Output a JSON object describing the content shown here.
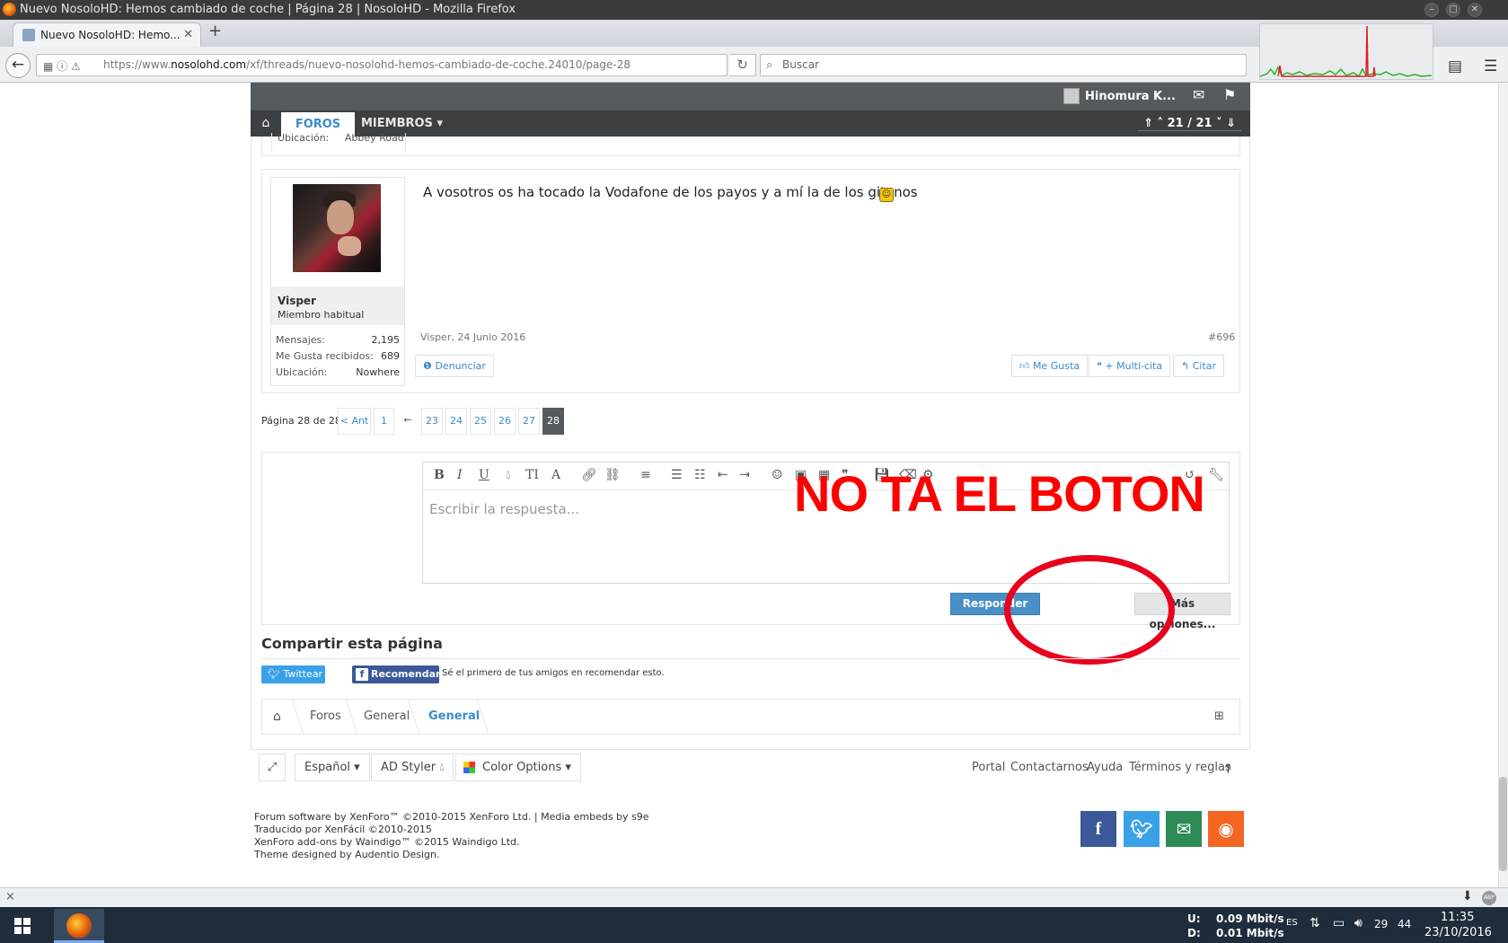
{
  "window": {
    "title": "Nuevo NosoloHD: Hemos cambiado de coche | Página 28 | NosoloHD - Mozilla Firefox"
  },
  "browser": {
    "tab_label": "Nuevo NosoloHD: Hemo...",
    "url_prefix": "https://www.",
    "url_domain": "nosolohd.com",
    "url_path": "/xf/threads/nuevo-nosolohd-hemos-cambiado-de-coche.24010/page-28",
    "search_placeholder": "Buscar"
  },
  "site": {
    "user_name": "Hinomura K...",
    "nav_foros": "FOROS",
    "nav_miembros": "MIEMBROS",
    "nav_pager": "21 / 21"
  },
  "post": {
    "prev_location": "Ubicación:",
    "prev_location_val": "Abbey Road",
    "username": "Visper",
    "usertitle": "Miembro habitual",
    "stats": [
      {
        "label": "Mensajes:",
        "value": "2,195"
      },
      {
        "label": "Me Gusta recibidos:",
        "value": "689"
      },
      {
        "label": "Ubicación:",
        "value": "Nowhere"
      }
    ],
    "message": "A vosotros os ha tocado la Vodafone de los payos y a mí la de los gitanos",
    "meta": "Visper, 24 Junio 2016",
    "number": "#696",
    "report": "Denunciar",
    "like": "Me Gusta",
    "multiquote": "+ Multi-cita",
    "quote": "Citar"
  },
  "pagination": {
    "label": "Página 28 de 28",
    "prev": "< Ant",
    "first": "1",
    "skip": "←",
    "pages": [
      "23",
      "24",
      "25",
      "26",
      "27"
    ],
    "current": "28"
  },
  "reply": {
    "placeholder": "Escribir la respuesta...",
    "submit": "Responder",
    "more": "Más opciones..."
  },
  "annotation": {
    "text": "NO TA EL BOTON",
    "color": "#ff0000"
  },
  "share": {
    "title": "Compartir esta página",
    "tweet": "Twittear",
    "recommend": "Recomendar",
    "fb_text": "Sé el primero de tus amigos en recomendar esto."
  },
  "breadcrumb": [
    "Foros",
    "General",
    "General"
  ],
  "footer": {
    "language": "Español",
    "style": "AD Styler",
    "color_options": "Color Options",
    "links": [
      "Portal",
      "Contactarnos",
      "Ayuda",
      "Términos y reglas"
    ],
    "credits": [
      "Forum software by XenForo™ ©2010-2015 XenForo Ltd. | Media embeds by s9e",
      "Traducido por XenFácil ©2010-2015",
      "XenForo add-ons by Waindigo™ ©2015 Waindigo Ltd.",
      "Theme designed by Audentio Design."
    ]
  },
  "taskbar": {
    "up_label": "U:",
    "up_value": "0.09 Mbit/s",
    "down_label": "D:",
    "down_value": "0.01 Mbit/s",
    "lang": "ES",
    "tray_a": "29",
    "tray_b": "44",
    "time": "11:35",
    "date": "23/10/2016"
  },
  "colors": {
    "accent": "#3a8bcb",
    "nav_dark": "#3c4043",
    "twitter": "#3aa0e8",
    "facebook": "#3b5998",
    "email": "#2e8b57",
    "rss": "#f26522"
  }
}
